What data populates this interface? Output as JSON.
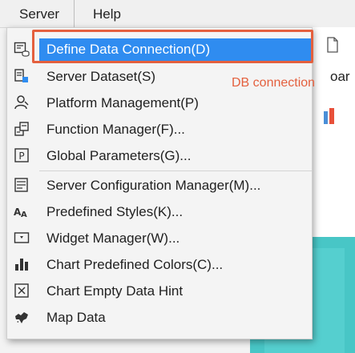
{
  "menubar": {
    "server_label": "Server",
    "help_label": "Help"
  },
  "background": {
    "partial_text": "oar"
  },
  "annotation": {
    "label": "DB connection",
    "color": "#e4603e"
  },
  "menu": {
    "highlight_color": "#2f8cf0",
    "items": [
      {
        "label": "Define Data Connection(D)",
        "icon": "data-connection-icon",
        "selected": true
      },
      {
        "label": "Server Dataset(S)",
        "icon": "server-dataset-icon"
      },
      {
        "label": "Platform Management(P)",
        "icon": "platform-user-icon"
      },
      {
        "label": "Function Manager(F)...",
        "icon": "function-manager-icon"
      },
      {
        "label": "Global Parameters(G)...",
        "icon": "global-parameter-icon"
      },
      {
        "label": "Server Configuration Manager(M)...",
        "icon": "server-config-icon"
      },
      {
        "label": "Predefined Styles(K)...",
        "icon": "predefined-styles-icon"
      },
      {
        "label": "Widget Manager(W)...",
        "icon": "widget-manager-icon"
      },
      {
        "label": "Chart Predefined Colors(C)...",
        "icon": "bar-chart-icon"
      },
      {
        "label": "Chart Empty Data Hint",
        "icon": "empty-data-hint-icon"
      },
      {
        "label": "Map Data",
        "icon": "map-data-icon"
      }
    ]
  }
}
